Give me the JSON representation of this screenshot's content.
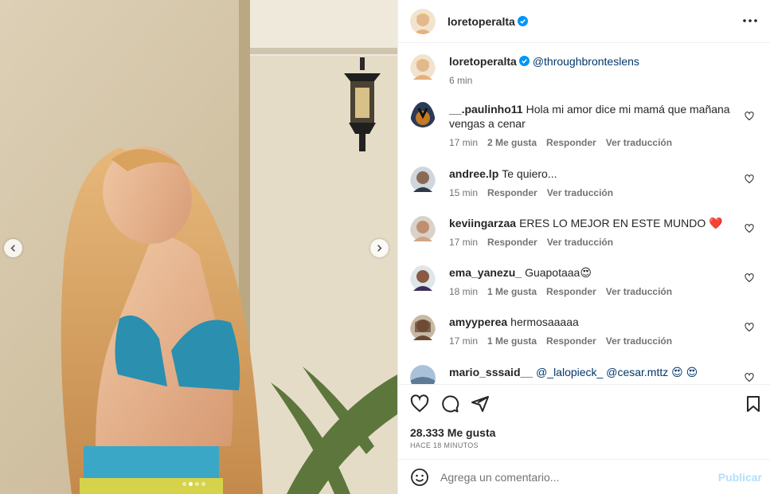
{
  "media": {
    "carousel_dots": 4,
    "active_dot": 1
  },
  "header": {
    "username": "loretoperalta",
    "verified": true
  },
  "caption": {
    "username": "loretoperalta",
    "mention": "@throughbronteslens",
    "time": "6 min"
  },
  "comments": [
    {
      "user": "__.paulinho11",
      "text": "Hola mi amor dice mi mamá que mañana vengas a cenar",
      "time": "17 min",
      "likes": "2 Me gusta",
      "reply": "Responder",
      "translate": "Ver traducción"
    },
    {
      "user": "andree.lp",
      "text": "Te quiero...",
      "time": "15 min",
      "likes": "",
      "reply": "Responder",
      "translate": "Ver traducción"
    },
    {
      "user": "keviingarzaa",
      "text": "ERES LO MEJOR EN ESTE MUNDO ❤️",
      "time": "17 min",
      "likes": "",
      "reply": "Responder",
      "translate": "Ver traducción"
    },
    {
      "user": "ema_yanezu_",
      "text": "Guapotaaa😍",
      "time": "18 min",
      "likes": "1 Me gusta",
      "reply": "Responder",
      "translate": "Ver traducción"
    },
    {
      "user": "amyyperea",
      "text": "hermosaaaaa",
      "time": "17 min",
      "likes": "1 Me gusta",
      "reply": "Responder",
      "translate": "Ver traducción"
    },
    {
      "user": "mario_sssaid__",
      "text": "@_lalopieck_ @cesar.mttz 😍 😍",
      "time": "",
      "likes": "",
      "reply": "",
      "translate": ""
    }
  ],
  "actions": {
    "likes": "28.333 Me gusta",
    "time": "HACE 18 MINUTOS"
  },
  "add_comment": {
    "placeholder": "Agrega un comentario...",
    "publish": "Publicar"
  },
  "icons": [
    "chevron-left-icon",
    "chevron-right-icon",
    "more-icon",
    "verified-icon",
    "heart-icon",
    "comment-icon",
    "share-icon",
    "bookmark-icon",
    "emoji-icon"
  ],
  "colors": {
    "verified": "#0095f6",
    "publish_disabled": "#b2dffc",
    "heart": "#e0245e"
  }
}
